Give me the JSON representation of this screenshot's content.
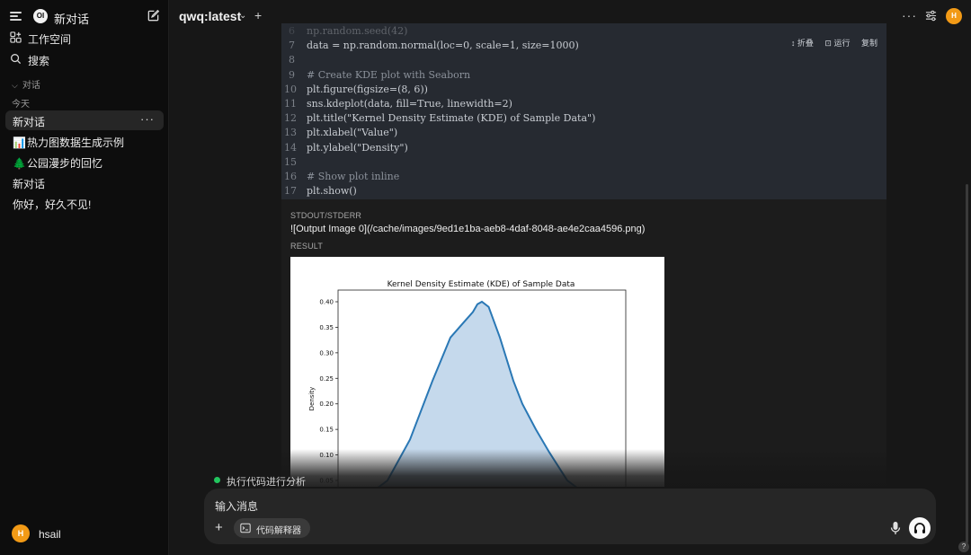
{
  "sidebar": {
    "app_title": "新对话",
    "logo_text": "OI",
    "nav": [
      {
        "label": "工作空间",
        "icon": "workspace-icon"
      },
      {
        "label": "搜索",
        "icon": "search-icon"
      }
    ],
    "section_label": "对话",
    "day_label": "今天",
    "chats": [
      {
        "label": "新对话",
        "emoji": "",
        "active": true
      },
      {
        "label": "热力图数据生成示例",
        "emoji": "📊",
        "active": false
      },
      {
        "label": "公园漫步的回忆",
        "emoji": "🌲",
        "active": false
      },
      {
        "label": "新对话",
        "emoji": "",
        "active": false
      },
      {
        "label": "你好，好久不见!",
        "emoji": "",
        "active": false
      }
    ],
    "more_label": "···",
    "user": {
      "initial": "H",
      "name": "hsail"
    }
  },
  "header": {
    "model": "qwq:latest",
    "add_label": "+",
    "more_label": "···",
    "avatar_initial": "H"
  },
  "code": {
    "actions": {
      "collapse": "折叠",
      "run": "运行",
      "copy": "复制"
    },
    "lines": [
      {
        "n": "6",
        "text": "np.random.seed(42)",
        "kind": "faded"
      },
      {
        "n": "7",
        "text": "data = np.random.normal(loc=0, scale=1, size=1000)",
        "kind": "code"
      },
      {
        "n": "8",
        "text": "",
        "kind": "code"
      },
      {
        "n": "9",
        "text": "# Create KDE plot with Seaborn",
        "kind": "comment"
      },
      {
        "n": "10",
        "text": "plt.figure(figsize=(8, 6))",
        "kind": "code"
      },
      {
        "n": "11",
        "text": "sns.kdeplot(data, fill=True, linewidth=2)",
        "kind": "code"
      },
      {
        "n": "12",
        "text": "plt.title(\"Kernel Density Estimate (KDE) of Sample Data\")",
        "kind": "code"
      },
      {
        "n": "13",
        "text": "plt.xlabel(\"Value\")",
        "kind": "code"
      },
      {
        "n": "14",
        "text": "plt.ylabel(\"Density\")",
        "kind": "code"
      },
      {
        "n": "15",
        "text": "",
        "kind": "code"
      },
      {
        "n": "16",
        "text": "# Show plot inline",
        "kind": "comment"
      },
      {
        "n": "17",
        "text": "plt.show()",
        "kind": "code"
      }
    ]
  },
  "output": {
    "stdout_label": "STDOUT/STDERR",
    "stdout_text": "![Output Image 0](/cache/images/9ed1e1ba-aeb8-4daf-8048-ae4e2caa4596.png)",
    "result_label": "RESULT"
  },
  "chart_data": {
    "type": "area",
    "title": "Kernel Density Estimate (KDE) of Sample Data",
    "ylabel": "Density",
    "y_ticks": [
      "0.40",
      "0.35",
      "0.30",
      "0.25",
      "0.20",
      "0.15",
      "0.10",
      "0.05"
    ],
    "ylim": [
      0,
      0.42
    ],
    "xlim": [
      -4,
      4
    ],
    "x": [
      -3.5,
      -3.0,
      -2.5,
      -2.0,
      -1.5,
      -1.0,
      -0.6,
      -0.3,
      -0.1,
      0.0,
      0.1,
      0.25,
      0.5,
      0.8,
      1.0,
      1.3,
      1.6,
      2.0,
      2.5,
      3.0,
      3.5
    ],
    "y": [
      0.002,
      0.006,
      0.017,
      0.05,
      0.13,
      0.245,
      0.33,
      0.36,
      0.38,
      0.395,
      0.4,
      0.39,
      0.33,
      0.245,
      0.2,
      0.15,
      0.105,
      0.05,
      0.017,
      0.005,
      0.001
    ],
    "fill_color": "#c5d9ec",
    "line_color": "#2a78b5"
  },
  "status": {
    "text": "执行代码进行分析"
  },
  "composer": {
    "placeholder": "输入消息",
    "plus": "+",
    "tool_chip": "代码解释器"
  },
  "help_label": "?",
  "colors": {
    "accent_orange": "#f29a16",
    "status_green": "#22c55e"
  }
}
